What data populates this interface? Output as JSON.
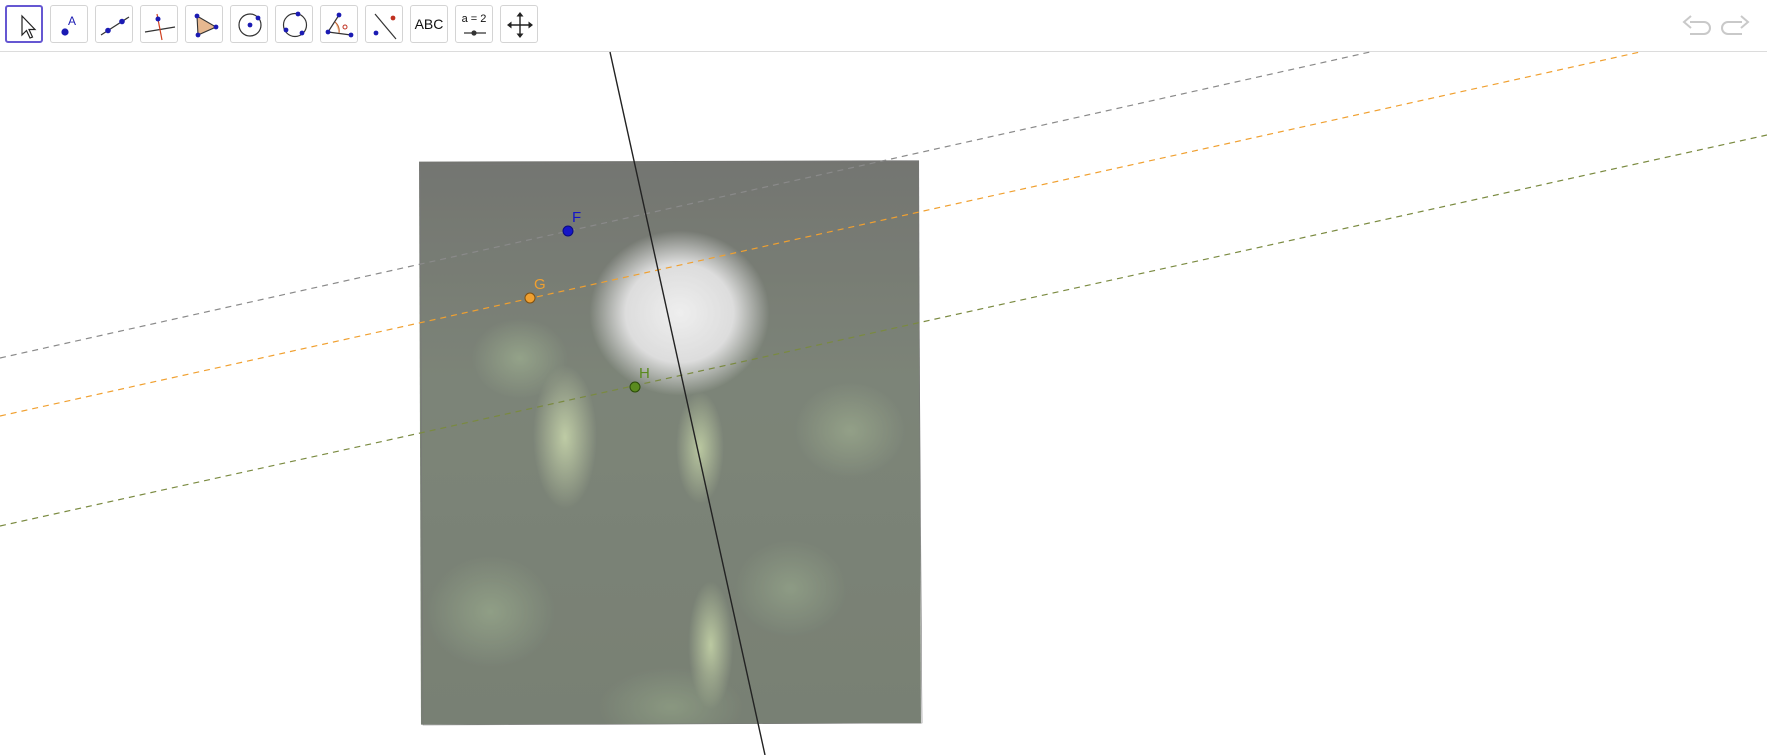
{
  "toolbar": {
    "tools": [
      {
        "id": "move",
        "icon": "cursor-arrow-icon"
      },
      {
        "id": "point",
        "icon": "point-icon",
        "label": "A"
      },
      {
        "id": "line",
        "icon": "line-through-two-points-icon"
      },
      {
        "id": "perpendicular",
        "icon": "perpendicular-line-icon"
      },
      {
        "id": "polygon",
        "icon": "polygon-icon"
      },
      {
        "id": "circle",
        "icon": "circle-center-point-icon"
      },
      {
        "id": "circle-three-points",
        "icon": "circle-three-points-icon"
      },
      {
        "id": "angle",
        "icon": "angle-icon"
      },
      {
        "id": "reflect",
        "icon": "reflect-about-line-icon"
      },
      {
        "id": "text",
        "icon": "text-icon",
        "label": "ABC"
      },
      {
        "id": "slider",
        "icon": "slider-icon",
        "label": "a = 2"
      },
      {
        "id": "move-graphics",
        "icon": "move-graphics-view-icon"
      }
    ],
    "selected": "move",
    "undo_icon": "undo-icon",
    "redo_icon": "redo-icon"
  },
  "points": [
    {
      "name": "F",
      "color": "#1515c8"
    },
    {
      "name": "G",
      "color": "#f0a030"
    },
    {
      "name": "H",
      "color": "#5a8a1e"
    }
  ],
  "colors": {
    "selected_border": "#6557d2",
    "line_gray": "#8a8a8a",
    "line_orange": "#f0a030",
    "line_green": "#7a8a40",
    "axis_line": "#222222"
  }
}
